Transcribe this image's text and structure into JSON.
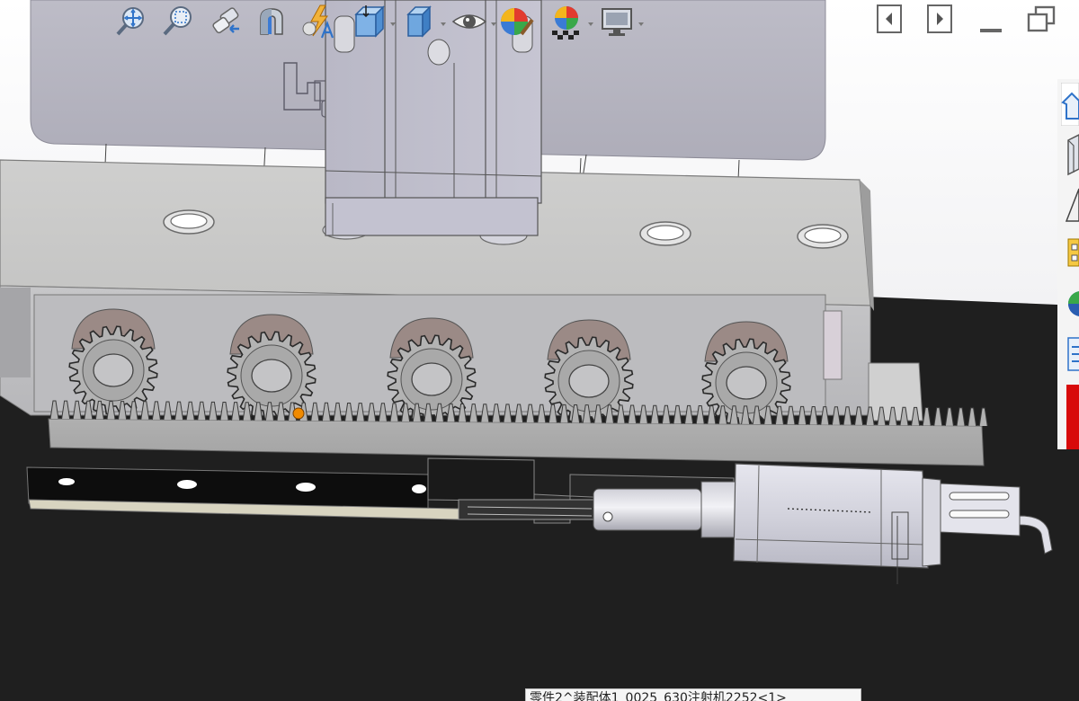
{
  "app": {
    "name": "3D CAD assembly viewport",
    "accent_color": "#2f73c9"
  },
  "heads_up_toolbar": {
    "items": [
      {
        "icon": "zoom-to-fit-icon"
      },
      {
        "icon": "zoom-to-area-icon"
      },
      {
        "icon": "previous-view-icon"
      },
      {
        "icon": "section-view-icon"
      },
      {
        "icon": "dynamic-annotation-views-icon"
      },
      {
        "icon": "view-orientation-icon",
        "dropdown": true
      },
      {
        "icon": "display-style-icon",
        "dropdown": true
      },
      {
        "icon": "hide-show-items-icon",
        "dropdown": true
      },
      {
        "icon": "edit-appearance-icon"
      },
      {
        "icon": "apply-scene-icon",
        "dropdown": true
      },
      {
        "icon": "view-settings-icon",
        "dropdown": true
      }
    ]
  },
  "window_controls": {
    "items": [
      {
        "icon": "previous-window-icon"
      },
      {
        "icon": "next-window-icon"
      },
      {
        "icon": "minimize-icon"
      },
      {
        "icon": "restore-icon"
      }
    ]
  },
  "task_pane": {
    "tabs": [
      {
        "icon": "resources-home-icon"
      },
      {
        "icon": "design-library-icon"
      },
      {
        "icon": "file-explorer-icon"
      },
      {
        "icon": "view-palette-icon"
      },
      {
        "icon": "appearances-scenes-icon"
      },
      {
        "icon": "custom-properties-icon"
      }
    ],
    "highlight_color": "#d80a0a"
  },
  "model": {
    "gear_count": 5,
    "selected_point_color": "#f08a00"
  },
  "status_bar": {
    "text": "零件2^装配体1_0025_630注射机2252<1>"
  }
}
